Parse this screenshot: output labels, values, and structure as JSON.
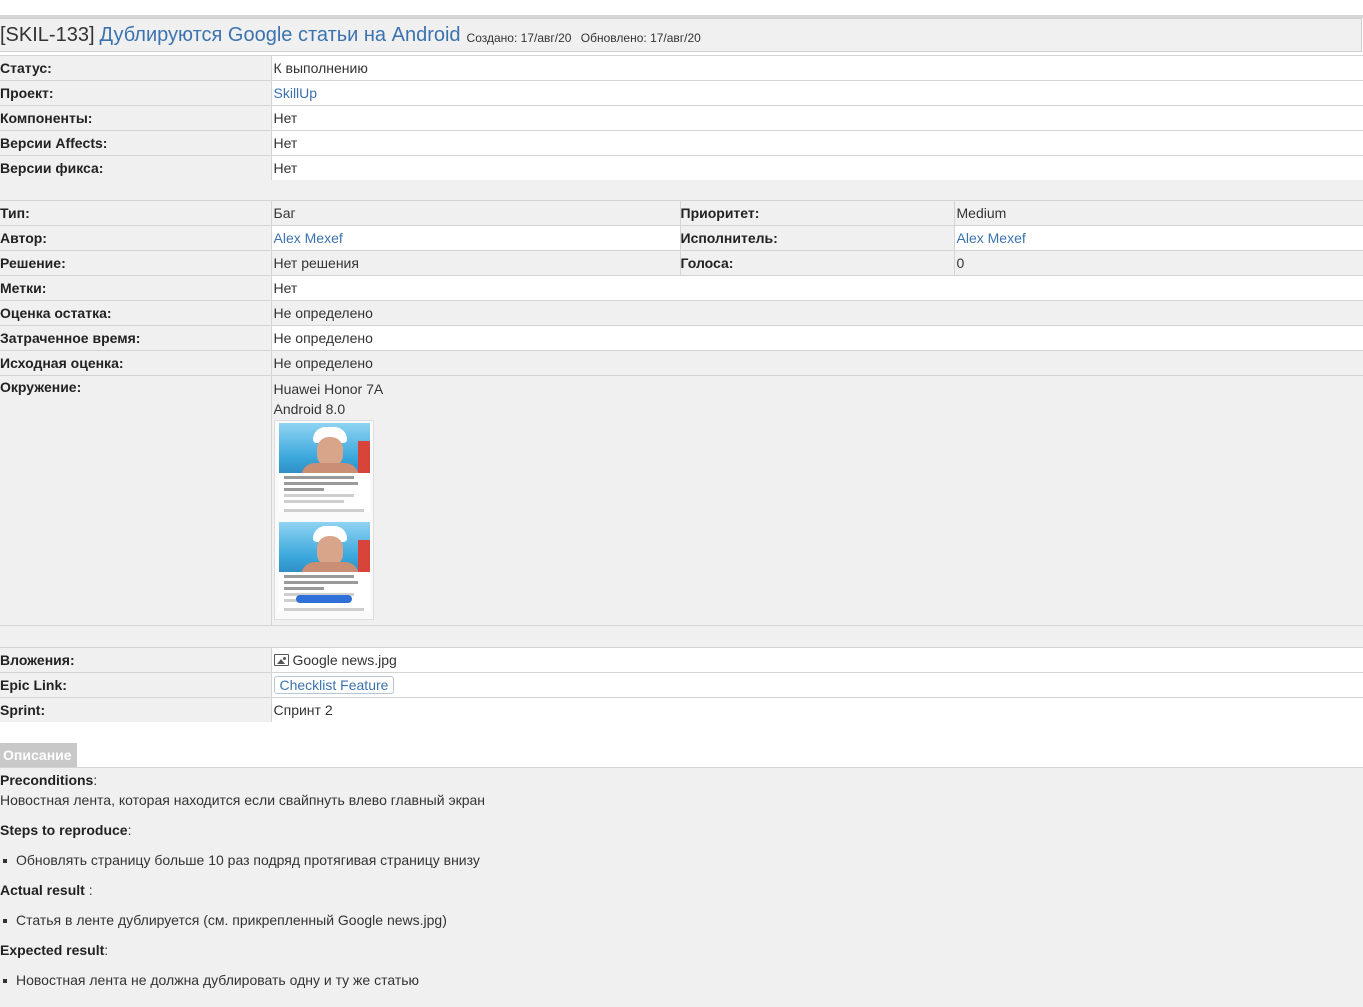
{
  "issue": {
    "key": "[SKIL-133]",
    "title": "Дублируются Google статьи на Android",
    "created_label": "Создано:",
    "created": "17/авг/20",
    "updated_label": "Обновлено:",
    "updated": "17/авг/20"
  },
  "summary_fields": [
    {
      "label": "Статус:",
      "value": "К выполнению"
    },
    {
      "label": "Проект:",
      "value": "SkillUp"
    },
    {
      "label": "Компоненты:",
      "value": "Нет"
    },
    {
      "label": "Версии Affects:",
      "value": "Нет"
    },
    {
      "label": "Версии фикса:",
      "value": "Нет"
    }
  ],
  "details": {
    "type": {
      "label": "Тип:",
      "value": "Баг"
    },
    "priority": {
      "label": "Приоритет:",
      "value": "Medium"
    },
    "author": {
      "label": "Автор:",
      "value": "Alex Mexef"
    },
    "assignee": {
      "label": "Исполнитель:",
      "value": "Alex Mexef"
    },
    "resolution": {
      "label": "Решение:",
      "value": "Нет решения"
    },
    "votes": {
      "label": "Голоса:",
      "value": "0"
    },
    "labels": {
      "label": "Метки:",
      "value": "Нет"
    },
    "remaining": {
      "label": "Оценка остатка:",
      "value": "Не определено"
    },
    "spent": {
      "label": "Затраченное время:",
      "value": "Не определено"
    },
    "original": {
      "label": "Исходная оценка:",
      "value": "Не определено"
    },
    "environment": {
      "label": "Окружение:",
      "line1": "Huawei Honor 7A",
      "line2": "Android 8.0"
    }
  },
  "extra": {
    "attachments": {
      "label": "Вложения:",
      "value": "Google news.jpg",
      "icon": "image-icon"
    },
    "epic": {
      "label": "Epic Link:",
      "value": "Checklist Feature"
    },
    "sprint": {
      "label": "Sprint:",
      "value": "Спринт 2"
    }
  },
  "description": {
    "tab": "Описание",
    "preconditions_h": "Preconditions",
    "preconditions_colon": ":",
    "preconditions_text": "Новостная лента, которая находится если свайпнуть влево главный экран",
    "steps_h": "Steps to reproduce",
    "steps_colon": ":",
    "steps": [
      "Обновлять страницу больше 10 раз подряд протягивая страницу внизу"
    ],
    "actual_h": "Actual result",
    "actual_colon": " :",
    "actual": [
      "Статья в ленте дублируется (см. прикрепленный Google news.jpg)"
    ],
    "expected_h": "Expected result",
    "expected_colon": ":",
    "expected": [
      "Новостная лента не должна дублировать одну и ту же статью"
    ]
  },
  "colors": {
    "link": "#3b73af",
    "label_bg": "#f0f0f0",
    "border": "#d4d4d4"
  }
}
